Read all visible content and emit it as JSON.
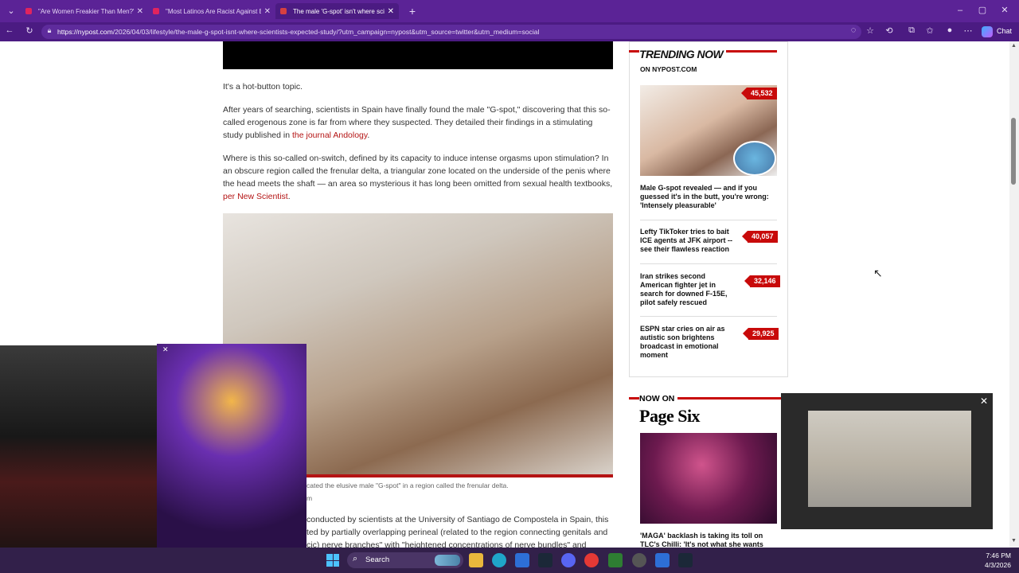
{
  "browser": {
    "tabs": [
      {
        "title": "\"Are Women Freakier Than Men?\"",
        "active": false
      },
      {
        "title": "\"Most Latinos Are Racist Against B",
        "active": false
      },
      {
        "title": "The male 'G-spot' isn't where scie",
        "active": true
      }
    ],
    "url_domain": "https://nypost.com",
    "url_path": "/2026/04/03/lifestyle/the-male-g-spot-isnt-where-scientists-expected-study/?utm_campaign=nypost&utm_source=twitter&utm_medium=social",
    "chat_label": "Chat"
  },
  "article": {
    "p1": "It's a hot-button topic.",
    "p2_text": "After years of searching, scientists in Spain have finally found the male \"G-spot,\" discovering that this so-called erogenous zone is far from where they suspected. They detailed their findings in a stimulating study published in ",
    "p2_link": "the journal Andology",
    "p2_end": ".",
    "p3_text": "Where is this so-called on-switch, defined by its capacity to induce intense orgasms upon stimulation? In an obscure region called the frenular delta, a triangular zone located on the underside of the penis where the head meets the shaft — an area so mysterious it has long been omitted from sexual health textbooks, ",
    "p3_link": "per New Scientist",
    "p3_end": ".",
    "caption": "cated the elusive male \"G-spot\" in a region called the frenular delta.",
    "credit": "m",
    "p4_l1": "conducted by scientists at the University of Santiago de Compostela in Spain, this",
    "p4_l2": "ted by partially overlapping perineal (related to the region connecting genitals and",
    "p4_l3": "cic) nerve branches\" with \"heightened concentrations of nerve bundles\" and"
  },
  "trending": {
    "title": "TRENDING NOW",
    "subtitle": "ON NYPOST.COM",
    "items": [
      {
        "title": "Male G-spot revealed — and if you guessed it's in the butt, you're wrong: 'Intensely pleasurable'",
        "count": "45,532"
      },
      {
        "title": "Lefty TikToker tries to bait ICE agents at JFK airport -- see their flawless reaction",
        "count": "40,057"
      },
      {
        "title": "Iran strikes second American fighter jet in search for downed F-15E, pilot safely rescued",
        "count": "32,146"
      },
      {
        "title": "ESPN star cries on air as autistic son brightens broadcast in emotional moment",
        "count": "29,925"
      }
    ]
  },
  "pagesix": {
    "now_on": "NOW ON",
    "brand": "Page Six",
    "headline": "'MAGA' backlash is taking its toll on TLC's Chilli: 'It's not what she wants"
  },
  "taskbar": {
    "search_label": "Search",
    "time": "7:46 PM",
    "date": "4/3/2026"
  },
  "colors": {
    "browser_purple": "#5b2396",
    "nypost_red": "#c80a0a"
  }
}
